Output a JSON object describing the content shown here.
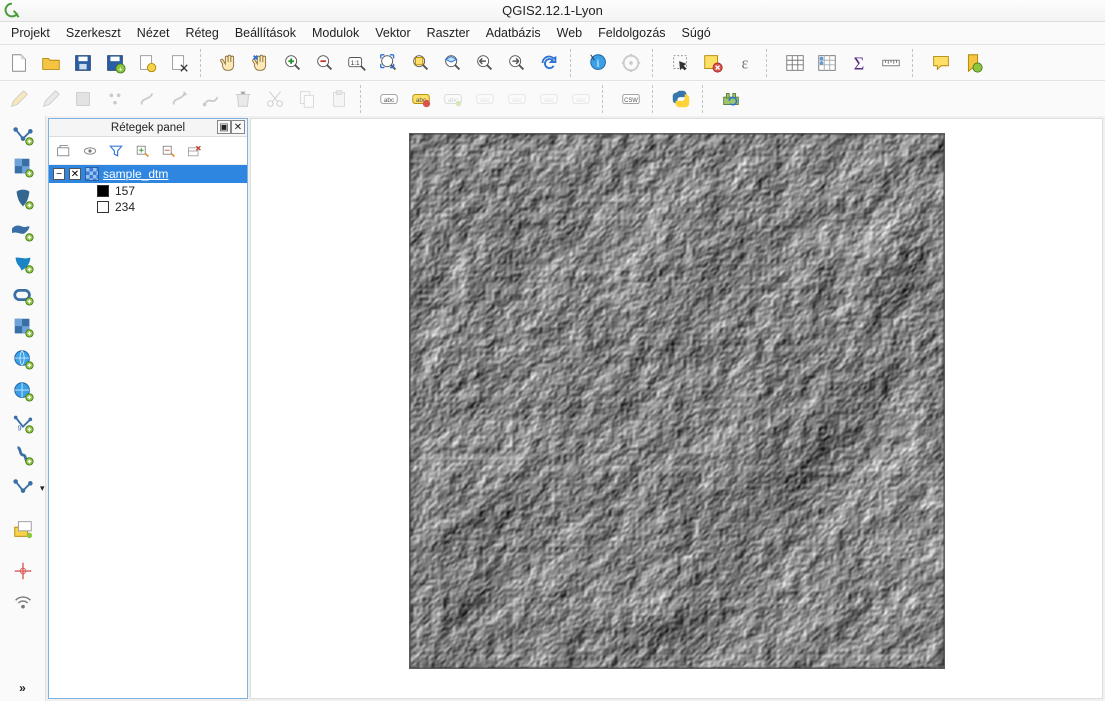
{
  "app": {
    "title": "QGIS2.12.1-Lyon"
  },
  "menubar": {
    "items": [
      "Projekt",
      "Szerkeszt",
      "Nézet",
      "Réteg",
      "Beállítások",
      "Modulok",
      "Vektor",
      "Raszter",
      "Adatbázis",
      "Web",
      "Feldolgozás",
      "Súgó"
    ]
  },
  "layers_panel": {
    "title": "Rétegek panel",
    "layer_name": "sample_dtm",
    "legend_min": "157",
    "legend_max": "234",
    "min_color": "#000000",
    "max_color": "#ffffff"
  },
  "icons": {
    "sigma": "Σ",
    "epsilon": "ε"
  }
}
